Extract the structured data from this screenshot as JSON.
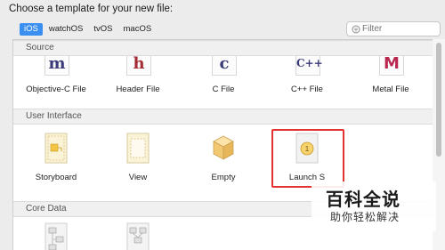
{
  "header": {
    "title": "Choose a template for your new file:"
  },
  "platform_tabs": [
    {
      "label": "iOS"
    },
    {
      "label": "watchOS"
    },
    {
      "label": "tvOS"
    },
    {
      "label": "macOS"
    }
  ],
  "filter": {
    "placeholder": "Filter"
  },
  "sections": {
    "source": {
      "title": "Source",
      "items": [
        {
          "label": "Objective-C File",
          "glyph": "m",
          "color": "#3a3a78"
        },
        {
          "label": "Header File",
          "glyph": "h",
          "color": "#a42a33"
        },
        {
          "label": "C File",
          "glyph": "c",
          "color": "#3a3a78"
        },
        {
          "label": "C++ File",
          "glyph": "C++",
          "color": "#3a3a78"
        },
        {
          "label": "Metal File",
          "glyph": "M",
          "color": "#b8284f"
        }
      ]
    },
    "user_interface": {
      "title": "User Interface",
      "items": [
        {
          "label": "Storyboard"
        },
        {
          "label": "View"
        },
        {
          "label": "Empty"
        },
        {
          "label": "Launch Screen",
          "visible_label": "Launch S"
        }
      ]
    },
    "core_data": {
      "title": "Core Data"
    }
  },
  "watermark": {
    "title": "百科全说",
    "subtitle": "助你轻松解决"
  },
  "colors": {
    "accent": "#3b8ff0",
    "highlight": "#e23232"
  }
}
